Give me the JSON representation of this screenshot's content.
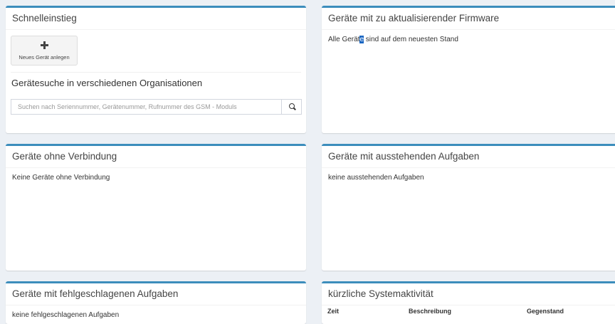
{
  "quick_start": {
    "title": "Schnelleinstieg",
    "new_device_label": "Neues Gerät anlegen",
    "search_title": "Gerätesuche in verschiedenen Organisationen",
    "search_placeholder": "Suchen nach Seriennummer, Gerätenummer, Rufnummer des GSM - Moduls",
    "search_icon": "search-icon",
    "plus_icon": "plus-icon"
  },
  "firmware": {
    "title": "Geräte mit zu aktualisierender Firmware",
    "message_before": "Alle Gerät",
    "message_selected": "e",
    "message_after": " sind auf dem neuesten Stand"
  },
  "offline": {
    "title": "Geräte ohne Verbindung",
    "message": "Keine Geräte ohne Verbindung"
  },
  "pending": {
    "title": "Geräte mit ausstehenden Aufgaben",
    "message": "keine ausstehenden Aufgaben"
  },
  "failed": {
    "title": "Geräte mit fehlgeschlagenen Aufgaben",
    "message": "keine fehlgeschlagenen Aufgaben"
  },
  "activity": {
    "title": "kürzliche Systemaktivität",
    "columns": [
      "Zeit",
      "Beschreibung",
      "Gegenstand"
    ]
  },
  "colors": {
    "accent": "#3c8dbc",
    "background": "#ecf0f5",
    "selection": "#1a66c2"
  }
}
